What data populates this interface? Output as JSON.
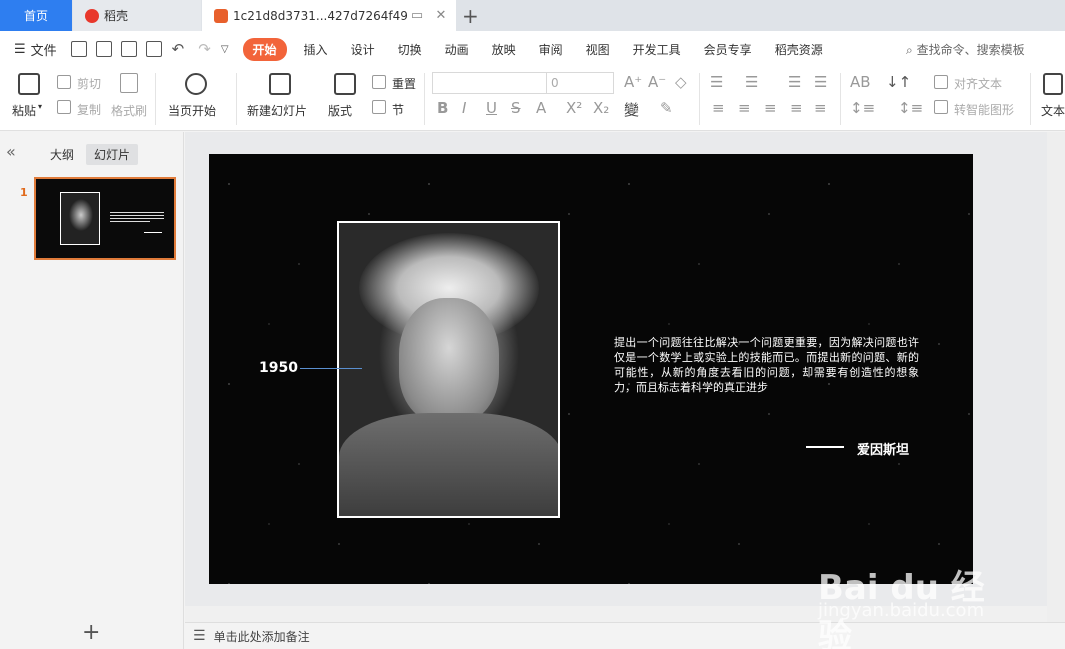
{
  "tabs": {
    "home": "首页",
    "daoke": "稻壳",
    "file": "1c21d8d3731...427d7264f49"
  },
  "menubar": {
    "file_menu": "文件",
    "items": [
      "开始",
      "插入",
      "设计",
      "切换",
      "动画",
      "放映",
      "审阅",
      "视图",
      "开发工具",
      "会员专享",
      "稻壳资源"
    ],
    "active": "开始",
    "search": "查找命令、搜索模板"
  },
  "ribbon": {
    "paste": "粘贴",
    "cut": "剪切",
    "copy": "复制",
    "format_painter": "格式刷",
    "play_from_current": "当页开始",
    "new_slide": "新建幻灯片",
    "layout": "版式",
    "reset": "重置",
    "section": "节",
    "font_size": "0",
    "align_text": "对齐文本",
    "smart_shape": "转智能图形",
    "textbox": "文本"
  },
  "left_panel": {
    "outline": "大纲",
    "slides": "幻灯片",
    "slide_number": "1"
  },
  "slide": {
    "year": "1950",
    "quote": "提出一个问题往往比解决一个问题更重要，因为解决问题也许仅是一个数学上或实验上的技能而已。而提出新的问题、新的可能性，从新的角度去看旧的问题，却需要有创造性的想象力，而且标志着科学的真正进步",
    "author": "爱因斯坦"
  },
  "notes": {
    "placeholder": "单击此处添加备注"
  },
  "watermark": {
    "brand": "Bai du 经验",
    "url": "jingyan.baidu.com"
  }
}
